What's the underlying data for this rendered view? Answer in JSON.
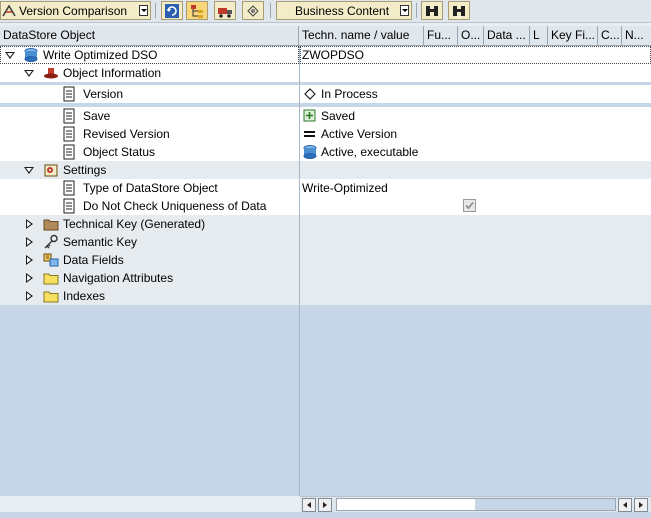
{
  "toolbar": {
    "version_comparison_label": "Version Comparison",
    "business_content_label": "Business Content"
  },
  "columns": [
    "DataStore Object",
    "Techn. name / value",
    "Fu...",
    "O...",
    "Data ...",
    "L",
    "Key Fi...",
    "C...",
    "N..."
  ],
  "tree": {
    "root": {
      "label": "Write Optimized DSO",
      "value": "ZWOPDSO"
    },
    "object_information": {
      "label": "Object Information"
    },
    "version": {
      "label": "Version",
      "value": "In Process"
    },
    "save": {
      "label": "Save",
      "value": "Saved"
    },
    "revised_version": {
      "label": "Revised Version",
      "value": "Active Version"
    },
    "object_status": {
      "label": "Object Status",
      "value": "Active, executable"
    },
    "settings": {
      "label": "Settings"
    },
    "type_of_dso": {
      "label": "Type of DataStore Object",
      "value": "Write-Optimized"
    },
    "do_not_check": {
      "label": "Do Not Check Uniqueness of Data",
      "checked": true
    },
    "technical_key": {
      "label": "Technical Key (Generated)"
    },
    "semantic_key": {
      "label": "Semantic Key"
    },
    "data_fields": {
      "label": "Data Fields"
    },
    "navigation_attributes": {
      "label": "Navigation Attributes"
    },
    "indexes": {
      "label": "Indexes"
    }
  },
  "colors": {
    "tree_bg": "#c6d6e6",
    "row_white": "#ffffff",
    "toolbar_btn": "#f3ecc8"
  }
}
